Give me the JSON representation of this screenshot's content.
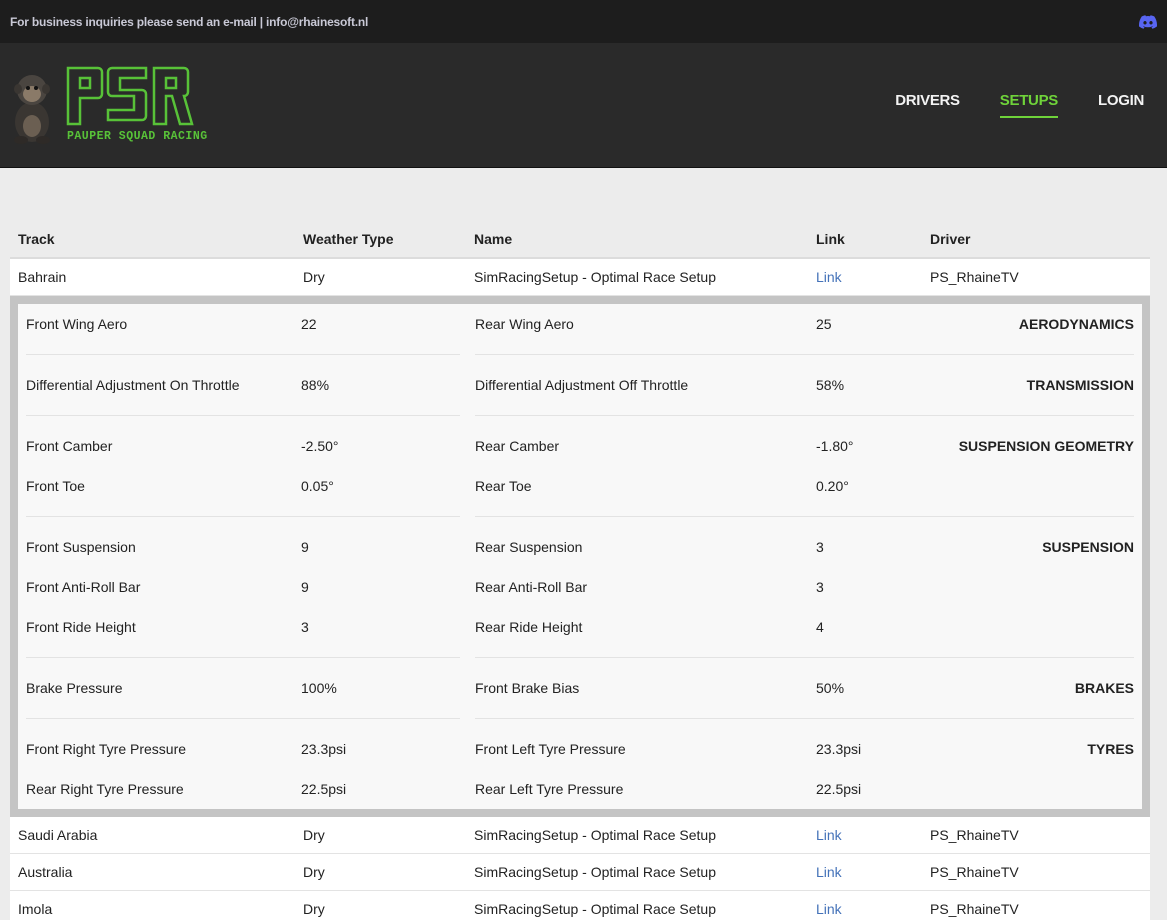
{
  "topbar": {
    "notice": "For business inquiries please send an e-mail | info@rhainesoft.nl",
    "discord_icon": "discord-icon"
  },
  "nav": {
    "items": [
      {
        "label": "DRIVERS"
      },
      {
        "label": "SETUPS"
      },
      {
        "label": "LOGIN"
      }
    ],
    "active": "SETUPS"
  },
  "logo": {
    "letters": "PSR",
    "tagline": "PAUPER SQUAD RACING"
  },
  "colors": {
    "accent": "#6fd33a",
    "link": "#4472b9",
    "topbar": "#1d1d1d",
    "header": "#2a2a2a"
  },
  "table": {
    "headers": {
      "track": "Track",
      "weather": "Weather Type",
      "name": "Name",
      "link": "Link",
      "driver": "Driver"
    },
    "rows": [
      {
        "track": "Bahrain",
        "weather": "Dry",
        "name": "SimRacingSetup - Optimal Race Setup",
        "link": "Link",
        "driver": "PS_RhaineTV"
      },
      {
        "track": "Saudi Arabia",
        "weather": "Dry",
        "name": "SimRacingSetup - Optimal Race Setup",
        "link": "Link",
        "driver": "PS_RhaineTV"
      },
      {
        "track": "Australia",
        "weather": "Dry",
        "name": "SimRacingSetup - Optimal Race Setup",
        "link": "Link",
        "driver": "PS_RhaineTV"
      },
      {
        "track": "Imola",
        "weather": "Dry",
        "name": "SimRacingSetup - Optimal Race Setup",
        "link": "Link",
        "driver": "PS_RhaineTV"
      }
    ]
  },
  "setup": {
    "aero": {
      "category": "AERODYNAMICS",
      "r1": {
        "l1": "Front Wing Aero",
        "v1": "22",
        "l2": "Rear Wing Aero",
        "v2": "25"
      }
    },
    "transmission": {
      "category": "TRANSMISSION",
      "r1": {
        "l1": "Differential Adjustment On Throttle",
        "v1": "88%",
        "l2": "Differential Adjustment Off Throttle",
        "v2": "58%"
      }
    },
    "geometry": {
      "category": "SUSPENSION GEOMETRY",
      "r1": {
        "l1": "Front Camber",
        "v1": "-2.50°",
        "l2": "Rear Camber",
        "v2": "-1.80°"
      },
      "r2": {
        "l1": "Front Toe",
        "v1": "0.05°",
        "l2": "Rear Toe",
        "v2": "0.20°"
      }
    },
    "suspension": {
      "category": "SUSPENSION",
      "r1": {
        "l1": "Front Suspension",
        "v1": "9",
        "l2": "Rear Suspension",
        "v2": "3"
      },
      "r2": {
        "l1": "Front Anti-Roll Bar",
        "v1": "9",
        "l2": "Rear Anti-Roll Bar",
        "v2": "3"
      },
      "r3": {
        "l1": "Front Ride Height",
        "v1": "3",
        "l2": "Rear Ride Height",
        "v2": "4"
      }
    },
    "brakes": {
      "category": "BRAKES",
      "r1": {
        "l1": "Brake Pressure",
        "v1": "100%",
        "l2": "Front Brake Bias",
        "v2": "50%"
      }
    },
    "tyres": {
      "category": "TYRES",
      "r1": {
        "l1": "Front Right Tyre Pressure",
        "v1": "23.3psi",
        "l2": "Front Left Tyre Pressure",
        "v2": "23.3psi"
      },
      "r2": {
        "l1": "Rear Right Tyre Pressure",
        "v1": "22.5psi",
        "l2": "Rear Left Tyre Pressure",
        "v2": "22.5psi"
      }
    }
  }
}
